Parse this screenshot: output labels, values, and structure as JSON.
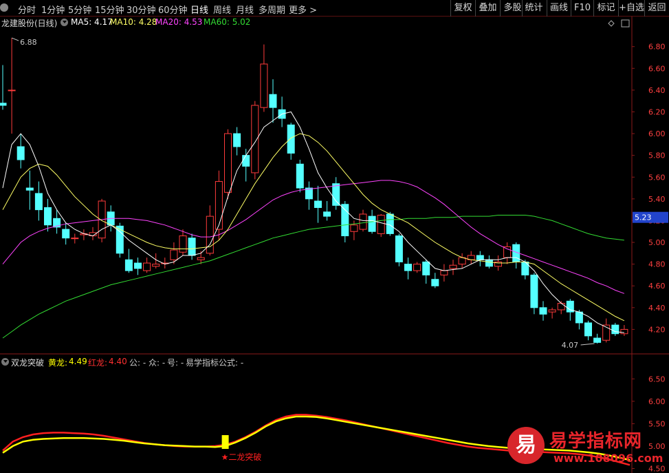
{
  "toolbar": {
    "periods": [
      "分时",
      "1分钟",
      "5分钟",
      "15分钟",
      "30分钟",
      "60分钟",
      "日线",
      "周线",
      "月线",
      "多周期",
      "更多 >"
    ],
    "active_period": "日线",
    "actions": [
      "复权",
      "叠加",
      "多股",
      "统计",
      "画线",
      "F10",
      "标记",
      "+自选",
      "返回"
    ]
  },
  "main_header": {
    "title": "龙建股份(日线)",
    "ma5_label": "MA5: 4.17",
    "ma10_label": "MA10: 4.28",
    "ma20_label": "MA20: 4.53",
    "ma60_label": "MA60: 5.02"
  },
  "indicator_header": {
    "name": "双龙突破",
    "huang_label": "黄龙:",
    "huang_value": "4.49",
    "hong_label": "红龙:",
    "hong_value": "4.40",
    "gong": "公: -",
    "zhong": "众: -",
    "hao": "号: -",
    "formula": "易学指标公式: -"
  },
  "colors": {
    "up": "#ff3b3b",
    "down": "#54ffff",
    "ma5": "#ffffff",
    "ma10": "#ffff66",
    "ma20": "#ff44ff",
    "ma60": "#33dd33",
    "huang": "#ffff00",
    "hong": "#ff2020",
    "axis": "#8b1a1a"
  },
  "logo": {
    "name": "易学指标网",
    "url": "www.108096.com",
    "mark": "易"
  },
  "chart_data": [
    {
      "type": "candlestick",
      "title": "龙建股份(日线)",
      "ylim": [
        4.0,
        6.95
      ],
      "yticks": [
        4.2,
        4.4,
        4.6,
        4.8,
        5.0,
        5.2,
        5.4,
        5.6,
        5.8,
        6.0,
        6.2,
        6.4,
        6.6,
        6.8
      ],
      "current_price_label": "5.23",
      "current_price": 5.23,
      "high_annotation": "6.88",
      "high_value": 6.88,
      "low_annotation": "4.07",
      "low_value": 4.07,
      "candles": [
        [
          6.28,
          6.26,
          6.63,
          6.22
        ],
        [
          6.4,
          6.4,
          6.88,
          6.0
        ],
        [
          5.88,
          5.76,
          6.0,
          5.68
        ],
        [
          5.5,
          5.48,
          5.66,
          5.3
        ],
        [
          5.45,
          5.3,
          5.56,
          5.2
        ],
        [
          5.32,
          5.16,
          5.4,
          5.1
        ],
        [
          5.22,
          5.14,
          5.3,
          5.08
        ],
        [
          5.12,
          5.04,
          5.18,
          4.98
        ],
        [
          5.04,
          5.04,
          5.08,
          4.99
        ],
        [
          5.07,
          5.08,
          5.12,
          5.02
        ],
        [
          5.06,
          5.09,
          5.14,
          5.02
        ],
        [
          5.04,
          5.38,
          5.4,
          5.0
        ],
        [
          5.28,
          5.16,
          5.34,
          5.1
        ],
        [
          5.15,
          4.9,
          5.18,
          4.86
        ],
        [
          4.84,
          4.74,
          4.94,
          4.72
        ],
        [
          4.81,
          4.76,
          4.86,
          4.7
        ],
        [
          4.74,
          4.81,
          4.86,
          4.72
        ],
        [
          4.78,
          4.8,
          4.9,
          4.76
        ],
        [
          4.81,
          4.81,
          4.86,
          4.76
        ],
        [
          4.84,
          4.93,
          5.0,
          4.8
        ],
        [
          4.91,
          5.06,
          5.12,
          4.88
        ],
        [
          5.04,
          4.88,
          5.08,
          4.84
        ],
        [
          4.84,
          4.86,
          4.92,
          4.8
        ],
        [
          4.9,
          5.24,
          5.34,
          4.88
        ],
        [
          5.12,
          5.56,
          5.66,
          5.02
        ],
        [
          5.46,
          6.0,
          6.04,
          5.4
        ],
        [
          6.0,
          5.88,
          6.06,
          5.8
        ],
        [
          5.8,
          5.7,
          5.86,
          5.56
        ],
        [
          5.64,
          6.26,
          6.3,
          5.58
        ],
        [
          6.24,
          6.64,
          6.82,
          6.2
        ],
        [
          6.36,
          6.24,
          6.5,
          6.1
        ],
        [
          6.22,
          6.14,
          6.34,
          6.06
        ],
        [
          6.08,
          5.82,
          6.1,
          5.76
        ],
        [
          5.72,
          5.5,
          5.76,
          5.46
        ],
        [
          5.5,
          5.4,
          5.56,
          5.3
        ],
        [
          5.38,
          5.32,
          5.52,
          5.18
        ],
        [
          5.28,
          5.24,
          5.38,
          5.2
        ],
        [
          5.54,
          5.34,
          5.6,
          5.3
        ],
        [
          5.35,
          5.06,
          5.38,
          5.0
        ],
        [
          5.1,
          5.16,
          5.2,
          5.02
        ],
        [
          5.12,
          5.26,
          5.3,
          5.1
        ],
        [
          5.24,
          5.1,
          5.3,
          5.08
        ],
        [
          5.08,
          5.25,
          5.26,
          5.05
        ],
        [
          5.26,
          5.08,
          5.28,
          5.06
        ],
        [
          5.06,
          4.82,
          5.08,
          4.78
        ],
        [
          4.8,
          4.74,
          4.86,
          4.66
        ],
        [
          4.74,
          4.8,
          4.82,
          4.72
        ],
        [
          4.82,
          4.7,
          4.84,
          4.62
        ],
        [
          4.66,
          4.6,
          4.72,
          4.58
        ],
        [
          4.7,
          4.74,
          4.8,
          4.64
        ],
        [
          4.76,
          4.79,
          4.84,
          4.7
        ],
        [
          4.8,
          4.86,
          4.9,
          4.76
        ],
        [
          4.84,
          4.88,
          4.92,
          4.8
        ],
        [
          4.88,
          4.84,
          4.92,
          4.78
        ],
        [
          4.84,
          4.78,
          4.88,
          4.76
        ],
        [
          4.78,
          4.82,
          4.88,
          4.74
        ],
        [
          4.86,
          4.96,
          5.0,
          4.8
        ],
        [
          4.98,
          4.82,
          5.0,
          4.76
        ],
        [
          4.82,
          4.7,
          4.84,
          4.66
        ],
        [
          4.7,
          4.4,
          4.72,
          4.34
        ],
        [
          4.4,
          4.34,
          4.46,
          4.28
        ],
        [
          4.36,
          4.38,
          4.4,
          4.3
        ],
        [
          4.38,
          4.44,
          4.46,
          4.34
        ],
        [
          4.46,
          4.36,
          4.48,
          4.28
        ],
        [
          4.36,
          4.26,
          4.38,
          4.2
        ],
        [
          4.26,
          4.14,
          4.28,
          4.1
        ],
        [
          4.12,
          4.08,
          4.16,
          4.07
        ],
        [
          4.1,
          4.24,
          4.3,
          4.08
        ],
        [
          4.24,
          4.16,
          4.26,
          4.14
        ],
        [
          4.16,
          4.2,
          4.24,
          4.14
        ]
      ],
      "ma5": [
        5.5,
        5.9,
        6.0,
        5.9,
        5.7,
        5.45,
        5.3,
        5.18,
        5.12,
        5.08,
        5.06,
        5.12,
        5.16,
        5.1,
        5.02,
        4.96,
        4.9,
        4.84,
        4.8,
        4.82,
        4.88,
        4.88,
        4.9,
        4.98,
        5.16,
        5.42,
        5.66,
        5.8,
        5.92,
        6.06,
        6.12,
        6.18,
        6.2,
        6.06,
        5.86,
        5.64,
        5.5,
        5.38,
        5.3,
        5.22,
        5.2,
        5.2,
        5.18,
        5.16,
        5.1,
        5.0,
        4.92,
        4.84,
        4.76,
        4.74,
        4.75,
        4.76,
        4.8,
        4.84,
        4.84,
        4.84,
        4.86,
        4.86,
        4.82,
        4.74,
        4.62,
        4.52,
        4.44,
        4.38,
        4.36,
        4.32,
        4.26,
        4.22,
        4.18,
        4.17
      ],
      "ma10": [
        5.3,
        5.45,
        5.6,
        5.68,
        5.72,
        5.7,
        5.62,
        5.52,
        5.42,
        5.34,
        5.26,
        5.2,
        5.16,
        5.12,
        5.08,
        5.04,
        5.0,
        4.97,
        4.95,
        4.94,
        4.94,
        4.94,
        4.95,
        4.96,
        5.02,
        5.12,
        5.26,
        5.4,
        5.54,
        5.66,
        5.78,
        5.88,
        5.96,
        6.0,
        5.98,
        5.92,
        5.84,
        5.74,
        5.64,
        5.54,
        5.44,
        5.36,
        5.3,
        5.26,
        5.22,
        5.18,
        5.12,
        5.06,
        5.0,
        4.95,
        4.9,
        4.86,
        4.84,
        4.83,
        4.82,
        4.81,
        4.81,
        4.82,
        4.82,
        4.8,
        4.74,
        4.68,
        4.62,
        4.57,
        4.52,
        4.47,
        4.42,
        4.37,
        4.32,
        4.28
      ],
      "ma20": [
        4.8,
        4.9,
        5.0,
        5.06,
        5.1,
        5.13,
        5.15,
        5.17,
        5.18,
        5.19,
        5.2,
        5.21,
        5.22,
        5.22,
        5.22,
        5.21,
        5.2,
        5.18,
        5.16,
        5.13,
        5.1,
        5.07,
        5.05,
        5.05,
        5.07,
        5.11,
        5.16,
        5.21,
        5.27,
        5.33,
        5.39,
        5.43,
        5.46,
        5.48,
        5.49,
        5.5,
        5.51,
        5.52,
        5.53,
        5.54,
        5.55,
        5.56,
        5.57,
        5.57,
        5.56,
        5.54,
        5.51,
        5.46,
        5.41,
        5.35,
        5.28,
        5.21,
        5.14,
        5.08,
        5.03,
        4.98,
        4.94,
        4.91,
        4.88,
        4.85,
        4.82,
        4.79,
        4.76,
        4.73,
        4.7,
        4.67,
        4.63,
        4.6,
        4.56,
        4.53
      ],
      "ma60": [
        4.12,
        4.18,
        4.24,
        4.29,
        4.34,
        4.38,
        4.42,
        4.46,
        4.49,
        4.52,
        4.55,
        4.58,
        4.61,
        4.63,
        4.65,
        4.67,
        4.69,
        4.71,
        4.73,
        4.75,
        4.77,
        4.79,
        4.81,
        4.83,
        4.86,
        4.89,
        4.92,
        4.95,
        4.98,
        5.01,
        5.04,
        5.06,
        5.08,
        5.1,
        5.12,
        5.13,
        5.14,
        5.15,
        5.16,
        5.17,
        5.18,
        5.19,
        5.2,
        5.21,
        5.21,
        5.22,
        5.22,
        5.22,
        5.23,
        5.23,
        5.23,
        5.24,
        5.24,
        5.24,
        5.24,
        5.25,
        5.25,
        5.25,
        5.25,
        5.24,
        5.22,
        5.2,
        5.17,
        5.14,
        5.11,
        5.08,
        5.06,
        5.04,
        5.03,
        5.02
      ]
    },
    {
      "type": "line",
      "title": "双龙突破",
      "ylim": [
        4.4,
        6.75
      ],
      "yticks": [
        4.5,
        5.0,
        5.5,
        6.0,
        6.5
      ],
      "series": [
        {
          "name": "黄龙",
          "values": [
            4.85,
            5.0,
            5.1,
            5.14,
            5.16,
            5.17,
            5.18,
            5.18,
            5.18,
            5.17,
            5.16,
            5.14,
            5.12,
            5.09,
            5.06,
            5.04,
            5.02,
            5.01,
            5.0,
            4.99,
            4.99,
            4.98,
            5.0,
            5.08,
            5.18,
            5.3,
            5.44,
            5.55,
            5.62,
            5.66,
            5.66,
            5.65,
            5.62,
            5.58,
            5.54,
            5.5,
            5.46,
            5.42,
            5.38,
            5.34,
            5.3,
            5.26,
            5.22,
            5.18,
            5.14,
            5.1,
            5.06,
            5.03,
            5.0,
            4.98,
            4.96,
            4.95,
            4.94,
            4.93,
            4.92,
            4.91,
            4.9,
            4.88,
            4.86,
            4.83,
            4.79,
            4.74,
            4.69
          ]
        },
        {
          "name": "红龙",
          "values": [
            4.9,
            5.1,
            5.2,
            5.26,
            5.29,
            5.3,
            5.3,
            5.29,
            5.28,
            5.26,
            5.23,
            5.19,
            5.15,
            5.11,
            5.07,
            5.04,
            5.02,
            5.0,
            4.99,
            4.99,
            4.99,
            5.0,
            5.03,
            5.1,
            5.2,
            5.32,
            5.46,
            5.58,
            5.66,
            5.7,
            5.7,
            5.68,
            5.65,
            5.61,
            5.57,
            5.52,
            5.47,
            5.42,
            5.37,
            5.32,
            5.27,
            5.22,
            5.17,
            5.12,
            5.07,
            5.03,
            4.99,
            4.96,
            4.94,
            4.92,
            4.9,
            4.89,
            4.88,
            4.87,
            4.86,
            4.85,
            4.84,
            4.82,
            4.79,
            4.75,
            4.7,
            4.64,
            4.58
          ]
        }
      ],
      "signal_index": 22,
      "signal_label": "★二龙突破"
    }
  ]
}
